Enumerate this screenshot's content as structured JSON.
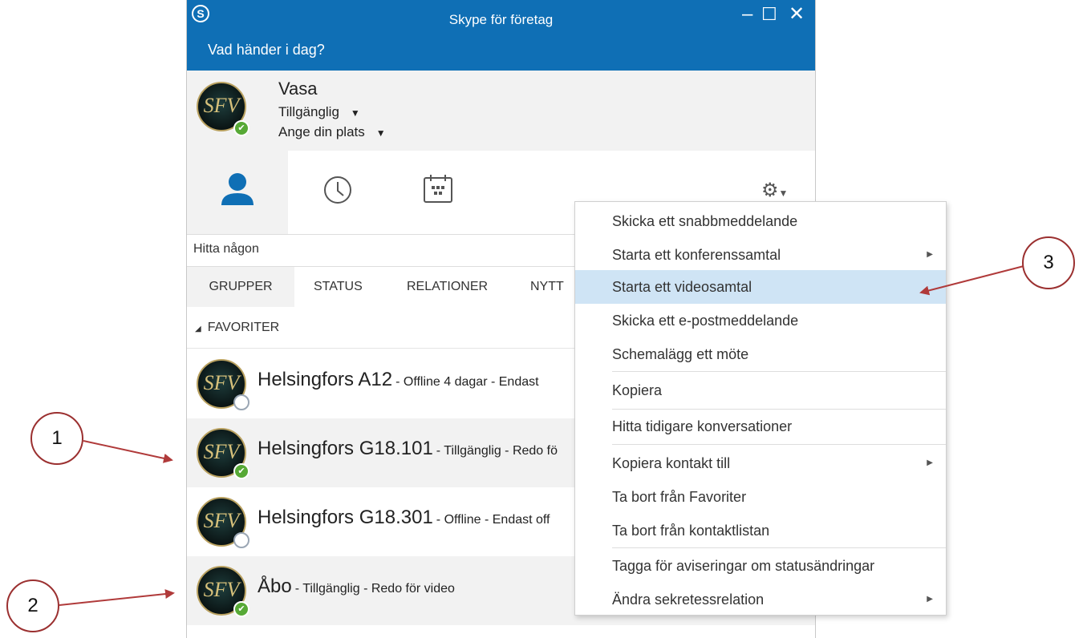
{
  "window": {
    "title": "Skype för företag",
    "logo": "S",
    "controls": {
      "minimize": "–",
      "maximize": "☐",
      "close": "✕"
    },
    "mood_placeholder": "Vad händer i dag?"
  },
  "profile": {
    "name": "Vasa",
    "status": "Tillgänglig",
    "location": "Ange din plats",
    "avatar_initials": "SFV"
  },
  "search": {
    "placeholder": "Hitta någon"
  },
  "tabs": [
    "GRUPPER",
    "STATUS",
    "RELATIONER",
    "NYTT"
  ],
  "group": {
    "name": "FAVORITER"
  },
  "contacts": [
    {
      "name": "Helsingfors A12",
      "status": "- Offline 4 dagar - Endast",
      "presence": "offline"
    },
    {
      "name": "Helsingfors G18.101",
      "status": "- Tillgänglig - Redo fö",
      "presence": "available"
    },
    {
      "name": "Helsingfors G18.301",
      "status": "- Offline - Endast off",
      "presence": "offline"
    },
    {
      "name": "Åbo",
      "status": "- Tillgänglig - Redo för video",
      "presence": "available"
    }
  ],
  "context_menu": {
    "items": [
      "Skicka ett snabbmeddelande",
      "Starta ett konferenssamtal",
      "Starta ett videosamtal",
      "Skicka ett e-postmeddelande",
      "Schemalägg ett möte",
      "Kopiera",
      "Hitta tidigare konversationer",
      "Kopiera kontakt till",
      "Ta bort från Favoriter",
      "Ta bort från kontaktlistan",
      "Tagga för aviseringar om statusändringar",
      "Ändra sekretessrelation"
    ],
    "highlighted": "Starta ett videosamtal"
  },
  "callouts": [
    "1",
    "2",
    "3"
  ],
  "colors": {
    "brand_blue": "#0f6fb5",
    "available_green": "#57a936",
    "menu_highlight": "#cfe4f5",
    "callout_red": "#b03a3a"
  }
}
